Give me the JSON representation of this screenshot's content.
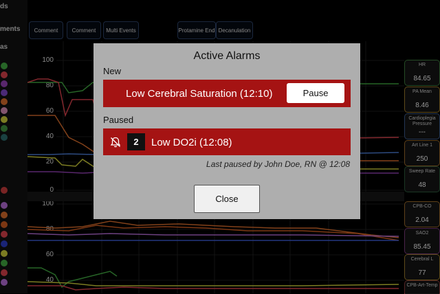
{
  "left_labels": [
    "ds",
    "ments",
    "as"
  ],
  "event_buttons": [
    "Comment",
    "Comment",
    "Multi Events",
    "Protamine End",
    "Decanulation"
  ],
  "chart_top": {
    "y_ticks": [
      "100",
      "80",
      "60",
      "40",
      "20",
      "0"
    ]
  },
  "chart_bottom": {
    "y_ticks": [
      "100",
      "80",
      "60",
      "40"
    ]
  },
  "vitals": [
    {
      "label": "HR",
      "value": "84.65",
      "color": "#3c7a3c"
    },
    {
      "label": "PA Mean",
      "value": "8.46",
      "color": "#9a7a2a"
    },
    {
      "label": "Cardioplegia Pressure",
      "value": "---",
      "color": "#3a5a8a"
    },
    {
      "label": "Art Line 1",
      "value": "250",
      "color": "#9a6a2a"
    },
    {
      "label": "Sweep Rate",
      "value": "48",
      "color": "#2a5a3a"
    },
    {
      "label": "CPB-CO",
      "value": "2.04",
      "color": "#9a6a2a"
    },
    {
      "label": "SAO2",
      "value": "85.45",
      "color": "#7a3a7a"
    },
    {
      "label": "Cerebral L",
      "value": "77",
      "color": "#9a7a2a"
    },
    {
      "label": "CPB-Art-Temp",
      "value": "",
      "color": "#8a3a3a"
    }
  ],
  "modal": {
    "title": "Active Alarms",
    "new_label": "New",
    "new_alarm": "Low Cerebral Saturation (12:10)",
    "pause_label": "Pause",
    "paused_label": "Paused",
    "paused_count": "2",
    "paused_alarm": "Low DO2i (12:08)",
    "last_paused": "Last paused by John Doe, RN @ 12:08",
    "close_label": "Close",
    "alarm_color": "#a51313",
    "icons": {
      "paused": "bell-off-icon"
    }
  }
}
